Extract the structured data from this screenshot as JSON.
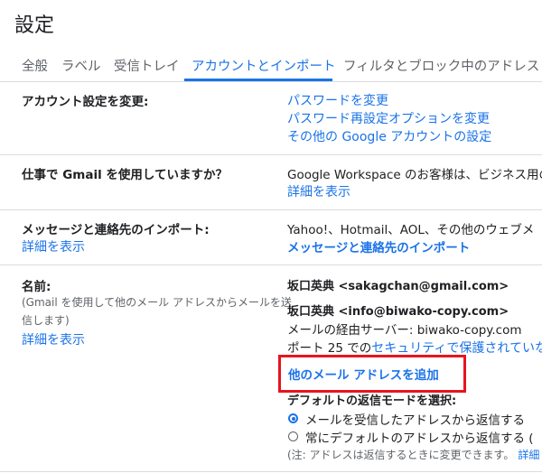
{
  "title": "設定",
  "tabs": [
    {
      "label": "全般"
    },
    {
      "label": "ラベル"
    },
    {
      "label": "受信トレイ"
    },
    {
      "label": "アカウントとインポート"
    },
    {
      "label": "フィルタとブロック中のアドレス"
    }
  ],
  "account": {
    "label": "アカウント設定を変更:",
    "links": [
      "パスワードを変更",
      "パスワード再設定オプションを変更",
      "その他の Google アカウントの設定"
    ]
  },
  "work": {
    "label": "仕事で Gmail を使用していますか？",
    "desc": "Google Workspace のお客様は、ビジネス用の",
    "link": "詳細を表示"
  },
  "import": {
    "label": "メッセージと連絡先のインポート:",
    "learn_more": "詳細を表示",
    "desc": "Yahoo!、Hotmail、AOL、その他のウェブメ",
    "action": "メッセージと連絡先のインポート"
  },
  "name": {
    "label": "名前:",
    "desc_line1": "(Gmail を使用して他のメール アドレスからメールを送",
    "desc_line2": "信します)",
    "learn_more": "詳細を表示",
    "address1": "坂口英典 <sakagchan@gmail.com>",
    "address2": "坂口英典 <info@biwako-copy.com>",
    "server": "メールの経由サーバー: biwako-copy.com",
    "port_prefix": "ポート 25 での",
    "port_link": "セキュリティで保護されていな",
    "add_address": "他のメール アドレスを追加",
    "reply_mode_label": "デフォルトの返信モードを選択:",
    "reply_options": [
      {
        "label": "メールを受信したアドレスから返信する",
        "selected": true
      },
      {
        "label": "常にデフォルトのアドレスから返信する (",
        "selected": false
      }
    ],
    "note": "(注: アドレスは返信するときに変更できます。",
    "note_link": "詳細",
    "highlight_color": "#e8141e"
  },
  "accent_color": "#1a73e8"
}
